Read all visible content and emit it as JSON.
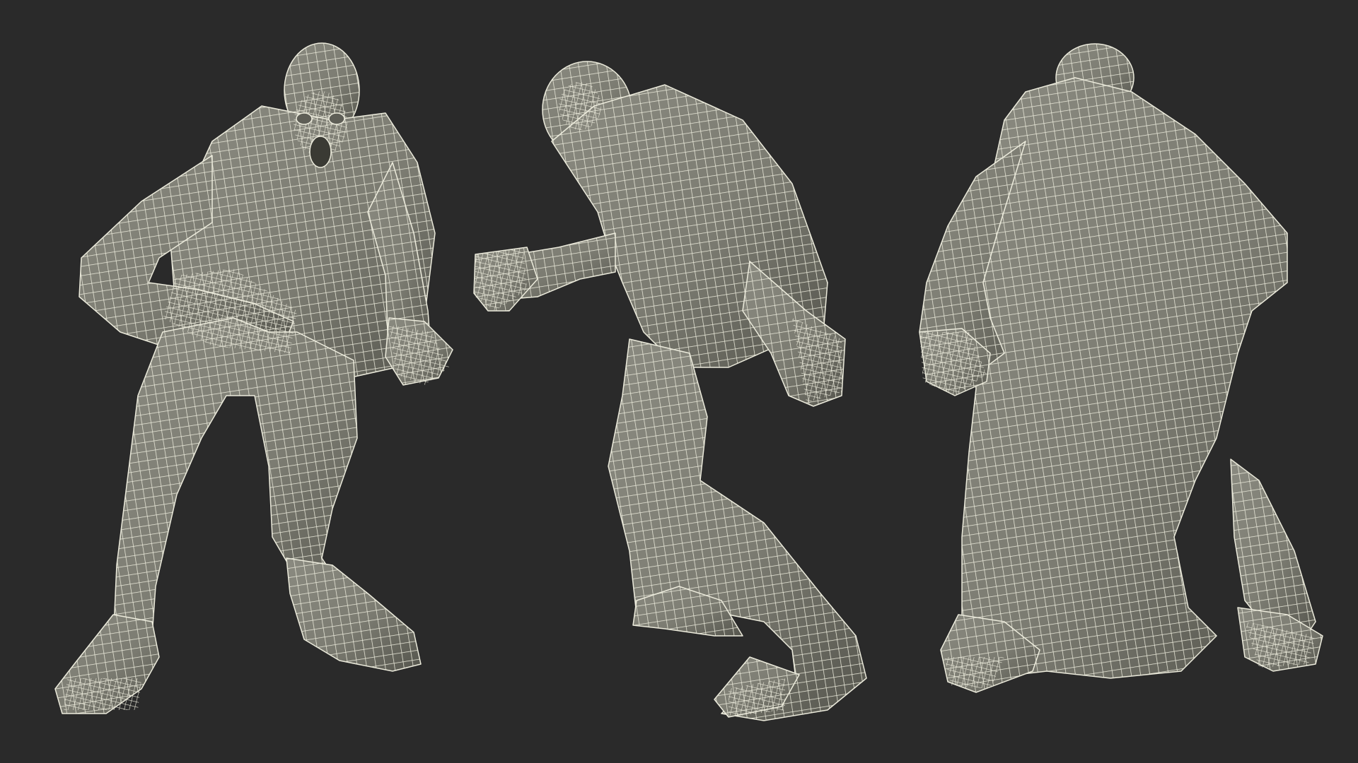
{
  "scene": {
    "background_color": "#2a2a2a",
    "mesh_fill_color": "#7c7c72",
    "mesh_shadow_color": "#55554d",
    "wire_color": "#ecebdc",
    "views": [
      {
        "id": "front",
        "name": "front-view"
      },
      {
        "id": "side",
        "name": "side-view"
      },
      {
        "id": "back",
        "name": "back-view"
      }
    ]
  }
}
